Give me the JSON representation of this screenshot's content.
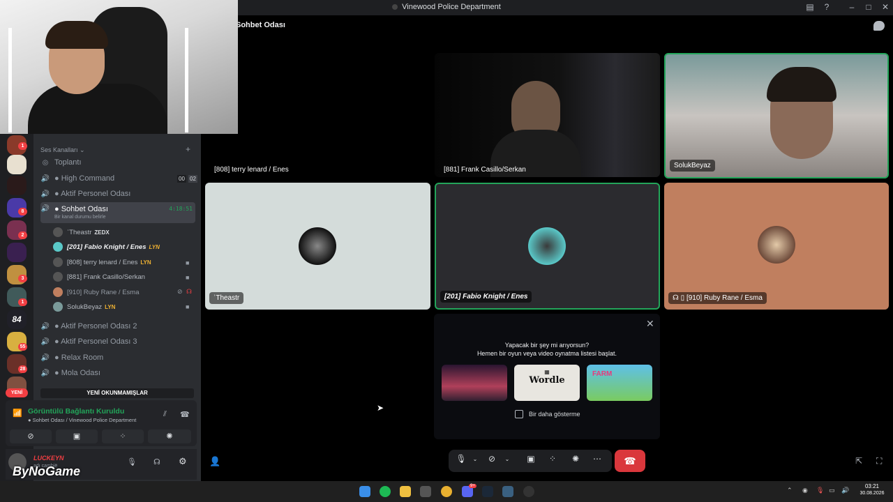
{
  "window": {
    "title": "Vinewood Police Department"
  },
  "channel_header": {
    "title": "Sohbet Odası"
  },
  "sidebar": {
    "category": "Ses Kanalları",
    "channels": [
      {
        "name": "Toplantı"
      },
      {
        "name": "● High Command",
        "counter_a": "00",
        "counter_b": "02"
      },
      {
        "name": "● Aktif Personel Odası"
      },
      {
        "name": "● Sohbet Odası",
        "timer": "4:18:51",
        "status": "Bir kanal durumu belirle"
      },
      {
        "name": "● Aktif Personel Odası 2"
      },
      {
        "name": "● Aktif Personel Odası 3"
      },
      {
        "name": "● Relax Room"
      },
      {
        "name": "● Mola Odası"
      }
    ],
    "members": [
      {
        "name": "ʾTheastr",
        "tag": "ZEDX"
      },
      {
        "name": "[201] Fabio Knight / Enes",
        "tag": "LYN"
      },
      {
        "name": "[808] terry lenard / Enes",
        "tag": "LYN"
      },
      {
        "name": "[881] Frank Casillo/Serkan",
        "tag": ""
      },
      {
        "name": "[910] Ruby Rane / Esma",
        "tag": ""
      },
      {
        "name": "SolukBeyaz",
        "tag": "LYN"
      }
    ],
    "server_badges": [
      "1",
      "8",
      "2",
      "3",
      "1",
      "55",
      "28"
    ],
    "server_label_84": "84",
    "new_unread": "YENİ OKUNMAMIŞLAR",
    "yeni": "YENİ"
  },
  "voice_panel": {
    "status": "Görüntülü Bağlantı Kuruldu",
    "location": "Sohbet Odası / Vinewood Police Department"
  },
  "user_panel": {
    "username": "LUCKEYN",
    "status": "adı cambië",
    "watermark": "ByNoGame"
  },
  "tiles": [
    {
      "name": "[808] terry lenard / Enes"
    },
    {
      "name": "[881] Frank Casillo/Serkan"
    },
    {
      "name": "SolukBeyaz"
    },
    {
      "name": "ʾTheastr"
    },
    {
      "name": "[201] Fabio Knight / Enes"
    },
    {
      "name": "[910] Ruby Rane / Esma"
    }
  ],
  "activity": {
    "line1": "Yapacak bir şey mi arıyorsun?",
    "line2": "Hemen bir oyun veya video oynatma listesi başlat.",
    "game_wordle": "Wordle",
    "game_farm": "FARM",
    "checkbox_label": "Bir daha gösterme"
  },
  "taskbar": {
    "time": "03:21",
    "date": "30.08.2026",
    "badge": "9+"
  },
  "colors": {
    "accent_green": "#23a55a",
    "danger": "#da373c",
    "blurple": "#5865f2"
  }
}
